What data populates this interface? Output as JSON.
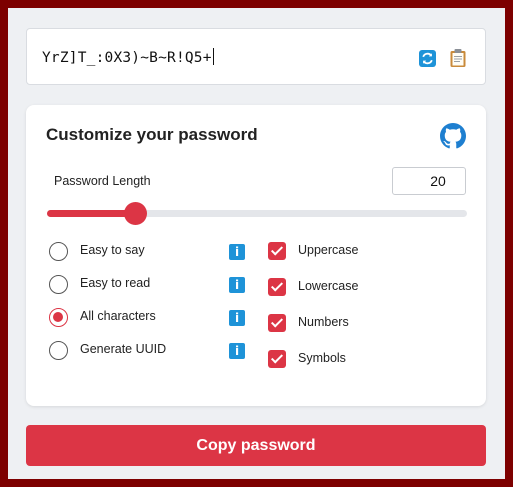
{
  "password": {
    "value": "YrZ]T_:0X3)~B~R!Q5+"
  },
  "icons": {
    "refresh": "refresh-icon",
    "clipboard": "clipboard-icon",
    "github": "github-icon",
    "info": "info-icon"
  },
  "colors": {
    "accent": "#dc3545",
    "info": "#1e93d8",
    "frame": "#7d0000"
  },
  "card": {
    "title": "Customize your password",
    "length_label": "Password Length",
    "length_value": "20",
    "slider_fraction": 0.21
  },
  "modes": [
    {
      "label": "Easy to say",
      "checked": false
    },
    {
      "label": "Easy to read",
      "checked": false
    },
    {
      "label": "All characters",
      "checked": true
    },
    {
      "label": "Generate UUID",
      "checked": false
    }
  ],
  "info_glyph": "i",
  "charsets": [
    {
      "label": "Uppercase",
      "checked": true
    },
    {
      "label": "Lowercase",
      "checked": true
    },
    {
      "label": "Numbers",
      "checked": true
    },
    {
      "label": "Symbols",
      "checked": true
    }
  ],
  "copy_button": {
    "label": "Copy password"
  }
}
